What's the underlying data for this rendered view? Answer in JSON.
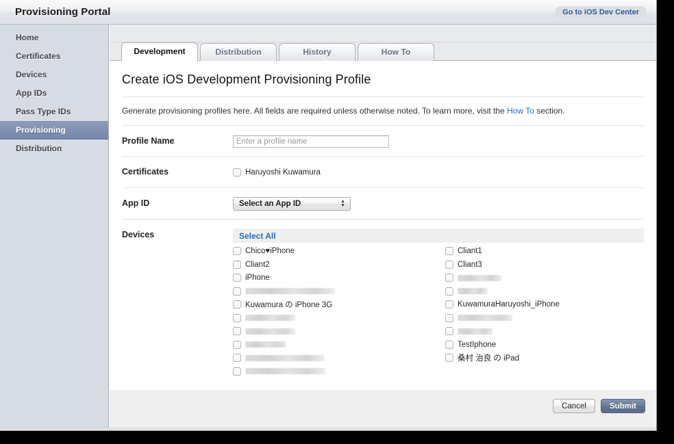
{
  "header": {
    "title": "Provisioning Portal",
    "dev_center_link": "Go to iOS Dev Center"
  },
  "sidebar": {
    "items": [
      {
        "label": "Home",
        "selected": false
      },
      {
        "label": "Certificates",
        "selected": false
      },
      {
        "label": "Devices",
        "selected": false
      },
      {
        "label": "App IDs",
        "selected": false
      },
      {
        "label": "Pass Type IDs",
        "selected": false
      },
      {
        "label": "Provisioning",
        "selected": true
      },
      {
        "label": "Distribution",
        "selected": false
      }
    ]
  },
  "tabs": [
    {
      "label": "Development",
      "active": true
    },
    {
      "label": "Distribution",
      "active": false
    },
    {
      "label": "History",
      "active": false
    },
    {
      "label": "How To",
      "active": false
    }
  ],
  "main": {
    "page_title": "Create iOS Development Provisioning Profile",
    "intro_before": "Generate provisioning profiles here. All fields are required unless otherwise noted. To learn more, visit the ",
    "intro_link": "How To",
    "intro_after": " section.",
    "profile_name": {
      "label": "Profile Name",
      "placeholder": "Enter a profile name",
      "value": ""
    },
    "certificates": {
      "label": "Certificates",
      "items": [
        {
          "label": "Haruyoshi Kuwamura",
          "checked": false
        }
      ]
    },
    "app_id": {
      "label": "App ID",
      "selected_option": "Select an App ID"
    },
    "devices": {
      "label": "Devices",
      "select_all": "Select All",
      "left_column": [
        {
          "label": "Chico♥iPhone",
          "checked": false,
          "redacted": false
        },
        {
          "label": "Cliant2",
          "checked": false,
          "redacted": false
        },
        {
          "label": "iPhone",
          "checked": false,
          "redacted": false
        },
        {
          "label": "",
          "checked": false,
          "redacted": true,
          "redacted_width": 131
        },
        {
          "label": "Kuwamura の iPhone 3G",
          "checked": false,
          "redacted": false
        },
        {
          "label": "",
          "checked": false,
          "redacted": true,
          "redacted_width": 73
        },
        {
          "label": "",
          "checked": false,
          "redacted": true,
          "redacted_width": 73
        },
        {
          "label": "",
          "checked": false,
          "redacted": true,
          "redacted_width": 60
        },
        {
          "label": "",
          "checked": false,
          "redacted": true,
          "redacted_width": 116
        },
        {
          "label": "",
          "checked": false,
          "redacted": true,
          "redacted_width": 117
        }
      ],
      "right_column": [
        {
          "label": "Cliant1",
          "checked": false,
          "redacted": false
        },
        {
          "label": "Cliant3",
          "checked": false,
          "redacted": false
        },
        {
          "label": "",
          "checked": false,
          "redacted": true,
          "redacted_width": 64
        },
        {
          "label": "",
          "checked": false,
          "redacted": true,
          "redacted_width": 44
        },
        {
          "label": "KuwamuraHaruyoshi_iPhone",
          "checked": false,
          "redacted": false
        },
        {
          "label": "",
          "checked": false,
          "redacted": true,
          "redacted_width": 80
        },
        {
          "label": "",
          "checked": false,
          "redacted": true,
          "redacted_width": 51
        },
        {
          "label": "TestIphone",
          "checked": false,
          "redacted": false
        },
        {
          "label": "桑村 治良 の iPad",
          "checked": false,
          "redacted": false
        }
      ]
    }
  },
  "footer": {
    "cancel_label": "Cancel",
    "submit_label": "Submit"
  },
  "colors": {
    "link_blue": "#2b6cb8",
    "sidebar_selected": "#7486ab",
    "submit_button": "#60728f",
    "sidebar_bg": "#d7dce4"
  }
}
